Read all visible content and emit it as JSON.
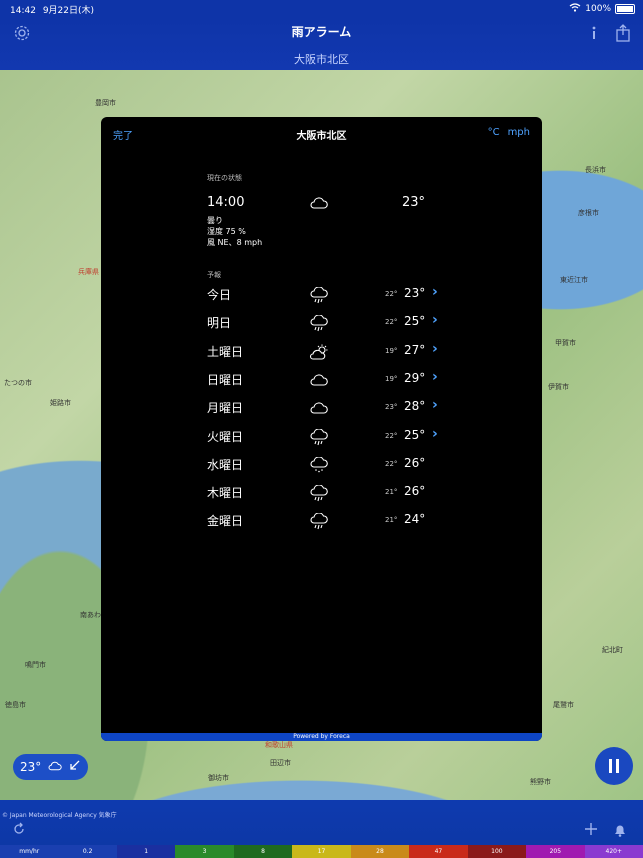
{
  "status": {
    "time": "14:42",
    "date": "9月22日(木)",
    "battery": "100%"
  },
  "nav": {
    "title": "雨アラーム",
    "subtitle": "大阪市北区",
    "settings_icon": "gear-icon",
    "info_icon": "info-icon",
    "share_icon": "share-icon"
  },
  "map_labels": [
    {
      "text": "豊岡市"
    },
    {
      "text": "長浜市"
    },
    {
      "text": "彦根市"
    },
    {
      "text": "東近江市"
    },
    {
      "text": "兵庫県"
    },
    {
      "text": "姫路市"
    },
    {
      "text": "たつの市"
    },
    {
      "text": "甲賀市"
    },
    {
      "text": "伊賀市"
    },
    {
      "text": "和歌山県"
    },
    {
      "text": "御坊市"
    },
    {
      "text": "田辺市"
    },
    {
      "text": "紀北町"
    },
    {
      "text": "徳島市"
    },
    {
      "text": "鳴門市"
    },
    {
      "text": "尾鷲市"
    },
    {
      "text": "熊野市"
    },
    {
      "text": "南あわじ"
    }
  ],
  "dialog": {
    "done": "完了",
    "title": "大阪市北区",
    "unit_temp": "°C",
    "unit_speed": "mph",
    "current_label": "現在の状態",
    "current": {
      "time": "14:00",
      "icon": "cloud-icon",
      "temp": "23°",
      "condition": "曇り",
      "humidity": "湿度 75 %",
      "wind": "風 NE、8 mph"
    },
    "forecast_label": "予報",
    "forecast": [
      {
        "day": "今日",
        "icon": "rain-icon",
        "low": "22°",
        "high": "23°",
        "more": true
      },
      {
        "day": "明日",
        "icon": "rain-icon",
        "low": "22°",
        "high": "25°",
        "more": true
      },
      {
        "day": "土曜日",
        "icon": "partly-sunny-icon",
        "low": "19°",
        "high": "27°",
        "more": true
      },
      {
        "day": "日曜日",
        "icon": "cloud-icon",
        "low": "19°",
        "high": "29°",
        "more": true
      },
      {
        "day": "月曜日",
        "icon": "cloud-icon",
        "low": "23°",
        "high": "28°",
        "more": true
      },
      {
        "day": "火曜日",
        "icon": "rain-icon",
        "low": "22°",
        "high": "25°",
        "more": true
      },
      {
        "day": "水曜日",
        "icon": "drizzle-icon",
        "low": "22°",
        "high": "26°",
        "more": false
      },
      {
        "day": "木曜日",
        "icon": "rain-icon",
        "low": "21°",
        "high": "26°",
        "more": false
      },
      {
        "day": "金曜日",
        "icon": "rain-icon",
        "low": "21°",
        "high": "24°",
        "more": false
      }
    ],
    "footer": "Powered by Foreca"
  },
  "overlay": {
    "temp": "23°"
  },
  "bottom": {
    "credit": "© Japan Meteorological Agency 気象庁"
  },
  "legend": [
    {
      "label": "mm/hr",
      "color": "#1a3fb0"
    },
    {
      "label": "0.2",
      "color": "#1a3fb0"
    },
    {
      "label": "1",
      "color": "#1a2fa0"
    },
    {
      "label": "3",
      "color": "#2a8a2a"
    },
    {
      "label": "8",
      "color": "#1f6a1f"
    },
    {
      "label": "17",
      "color": "#c9b81a"
    },
    {
      "label": "28",
      "color": "#c98a1a"
    },
    {
      "label": "47",
      "color": "#c92a1a"
    },
    {
      "label": "100",
      "color": "#8a1a1a"
    },
    {
      "label": "205",
      "color": "#a01ab0"
    },
    {
      "label": "420+",
      "color": "#8a3ad0"
    }
  ]
}
